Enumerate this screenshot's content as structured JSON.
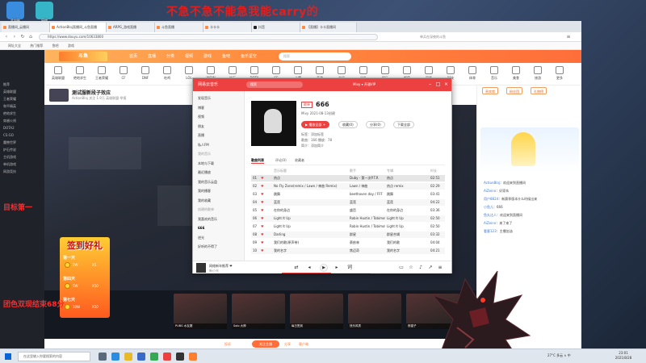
{
  "overlay": {
    "top_banner": "不急不急不能急我能carry的",
    "left_text_1": "目标第一",
    "left_text_2": "团色双现结束68分"
  },
  "desktop": {
    "icons": [
      {
        "label": "此电脑",
        "color": "#3a8dde"
      },
      {
        "label": "网络",
        "color": "#37b5c8"
      }
    ]
  },
  "browser": {
    "tabs": [
      {
        "label": "直播间_云播间",
        "active": false
      },
      {
        "label": "ActionBloj直播间_斗鱼直播",
        "active": true
      },
      {
        "label": "ARPG_游戏直播",
        "active": false
      },
      {
        "label": "斗鱼直播",
        "active": false
      },
      {
        "label": "卡卡卡",
        "active": false
      },
      {
        "label": "抖音",
        "active": false
      },
      {
        "label": "【直播】卡卡直播间",
        "active": false
      }
    ],
    "address": "https://www.douyu.com/10633800",
    "search_hint": "单兵在深夜的斗鱼",
    "bookmarks": [
      "网址大全",
      "热门推荐",
      "鱼吧",
      "游戏"
    ]
  },
  "douyu": {
    "logo": "斗鱼",
    "nav": [
      "首页",
      "直播",
      "分类",
      "视频",
      "游戏",
      "鱼吧",
      "鱼乐星空"
    ],
    "search_placeholder": "搜索",
    "sidebar": [
      "推荐",
      "英雄联盟",
      "王者荣耀",
      "和平精英",
      "绝地求生",
      "穿越火线",
      "DOTA2",
      "CS:GO",
      "魔兽世界",
      "炉石传说",
      "主机游戏",
      "单机游戏",
      "网游竞技"
    ],
    "categories": [
      "英雄联盟",
      "绝地求生",
      "王者荣耀",
      "CF",
      "DNF",
      "吃鸡",
      "LOL",
      "WOW",
      "炉石",
      "DOTA",
      "CS",
      "卡牌",
      "手游",
      "单机",
      "户外",
      "娱乐",
      "颜值",
      "星秀",
      "科技",
      "体育",
      "音乐",
      "美食",
      "旅游",
      "更多"
    ],
    "room": {
      "title": "测试服新段子效应",
      "subtitle": "ActionBlaj  关注 1.9万  英雄联盟  举报",
      "hot": "热度 52万"
    },
    "follow_button": "关注主播",
    "footer_links": [
      "投诉",
      "分享",
      "客户端"
    ],
    "chat": {
      "tabs": [
        "贵宾席",
        "粉丝团",
        "礼物榜"
      ],
      "messages": [
        {
          "user": "ActionBlaj",
          "text": "欢迎来到直播间"
        },
        {
          "user": "AiZeinn",
          "text": "好家伙"
        },
        {
          "user": "用户8824",
          "text": "新赛季版本什么时候出来"
        },
        {
          "user": "小鱼儿",
          "text": "666"
        },
        {
          "user": "鱼丸达人",
          "text": "欢迎来到直播间"
        },
        {
          "user": "AiZeinn",
          "text": "来了来了"
        },
        {
          "user": "看客123",
          "text": "主播加油"
        }
      ]
    },
    "gift_thumbs": [
      "PUBG 水友赛",
      "Solo 大神",
      "每日签到",
      "快乐风男",
      "夜猫子"
    ]
  },
  "music": {
    "brand": "网易云音乐",
    "search_placeholder": "搜索",
    "user": "Mivy ▾ 开通VIP",
    "sidebar": [
      {
        "label": "发现音乐",
        "head": false
      },
      {
        "label": "博客",
        "head": false
      },
      {
        "label": "视频",
        "head": false
      },
      {
        "label": "朋友",
        "head": false
      },
      {
        "label": "直播",
        "head": false
      },
      {
        "label": "私人FM",
        "head": false
      },
      {
        "label": "我的音乐",
        "head": true
      },
      {
        "label": "本地与下载",
        "head": false
      },
      {
        "label": "最近播放",
        "head": false
      },
      {
        "label": "我的音乐云盘",
        "head": false
      },
      {
        "label": "我的播客",
        "head": false
      },
      {
        "label": "我的收藏",
        "head": false
      },
      {
        "label": "创建的歌单",
        "head": true
      },
      {
        "label": "我喜欢的音乐",
        "head": false
      },
      {
        "label": "666",
        "head": false
      },
      {
        "label": "逆光",
        "head": false
      },
      {
        "label": "好听的不得了",
        "head": false
      }
    ],
    "playlist": {
      "tag": "歌单",
      "name": "666",
      "owner": "Mivy  2021-08-13创建",
      "play_all": "▶ 播放全部 +",
      "collect": "收藏(0)",
      "share": "分享(0)",
      "download": "下载全部",
      "tags_label": "标签：添加标签",
      "stats": "歌曲：166   播放：78",
      "intro": "简介：添加简介"
    },
    "tabs": [
      "歌曲列表",
      "评论(0)",
      "收藏者"
    ],
    "table_headers": [
      "音乐标题",
      "歌手",
      "专辑",
      "时长"
    ],
    "rows": [
      {
        "n": "01",
        "title": "热点",
        "artist": "Duby - 第一次P.T.R",
        "album": "热点",
        "time": "02:51"
      },
      {
        "n": "02",
        "title": "No Fly Zone(remix / Lawn / 神曲 Remix)",
        "artist": "Lawn / 神曲",
        "album": "热点 remix",
        "time": "02:29"
      },
      {
        "n": "03",
        "title": "跳舞",
        "artist": "beethoven day / FFF",
        "album": "跳舞",
        "time": "03:41"
      },
      {
        "n": "04",
        "title": "蓝莲",
        "artist": "蓝莲",
        "album": "蓝莲",
        "time": "04:22"
      },
      {
        "n": "05",
        "title": "在你的身边",
        "artist": "盛哲",
        "album": "在你的身边",
        "time": "03:36"
      },
      {
        "n": "06",
        "title": "Light It Up",
        "artist": "Robin Hustin / Tobimoto",
        "album": "Light It Up",
        "time": "02:50"
      },
      {
        "n": "07",
        "title": "Light It Up",
        "artist": "Robin Hustin / Tobimoto",
        "album": "Light It Up",
        "time": "02:50"
      },
      {
        "n": "08",
        "title": "Darling",
        "artist": "群星",
        "album": "群星合辑",
        "time": "03:32"
      },
      {
        "n": "09",
        "title": "我们的歌(原声带)",
        "artist": "蔡依林",
        "album": "我们的歌",
        "time": "04:04"
      },
      {
        "n": "10",
        "title": "我的名字",
        "artist": "焦迈奇",
        "album": "我的名字",
        "time": "04:21"
      }
    ],
    "now_playing": {
      "title": "网络新年推荐 ❤",
      "artist": "新小光"
    },
    "progress": 0.55
  },
  "dragon_overlay": "",
  "sign_badge": {
    "title": "签到好礼",
    "days": [
      {
        "label": "第一天",
        "reward1": "2W",
        "reward2": "X5"
      },
      {
        "label": "第四天",
        "reward1": "5W",
        "reward2": "X10"
      },
      {
        "label": "第七天",
        "reward1": "10W",
        "reward2": "X10"
      }
    ]
  },
  "taskbar": {
    "search_placeholder": "在这里输入你要搜索的内容",
    "tray": "27°C 多云 ∧ 中",
    "time": "23:01",
    "date": "2021/8/28"
  }
}
